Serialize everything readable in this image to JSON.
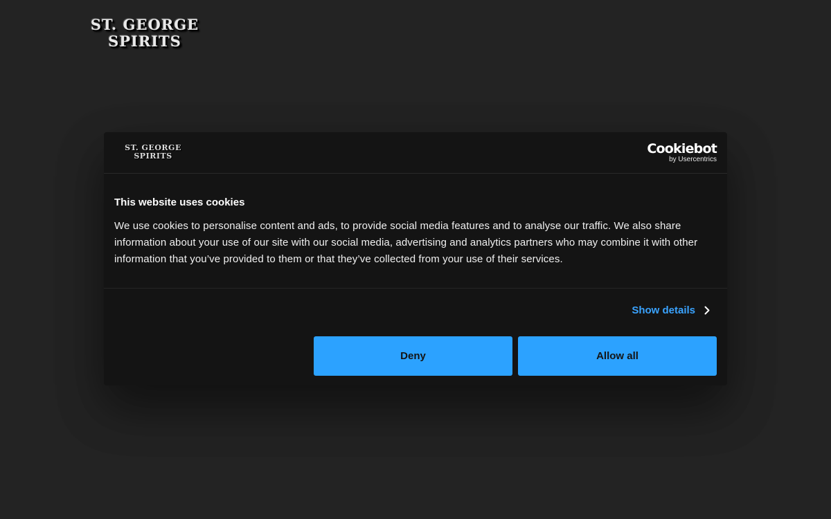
{
  "site": {
    "logo_line1": "ST. GEORGE",
    "logo_line2": "SPIRITS"
  },
  "dialog": {
    "logo_line1": "ST. GEORGE",
    "logo_line2": "SPIRITS",
    "provider_brand": "Cookiebot",
    "provider_sub": "by Usercentrics",
    "title": "This website uses cookies",
    "text": "We use cookies to personalise content and ads, to provide social media features and to analyse our traffic. We also share information about your use of our site with our social media, advertising and analytics partners who may combine it with other information that you’ve provided to them or that they’ve collected from your use of their services.",
    "show_details_label": "Show details",
    "show_details_icon": "chevron-right-icon",
    "deny_label": "Deny",
    "allow_all_label": "Allow all"
  },
  "colors": {
    "page_background": "#232323",
    "dialog_background": "#141414",
    "accent": "#2ca2ff",
    "link": "#3aa3ff"
  }
}
